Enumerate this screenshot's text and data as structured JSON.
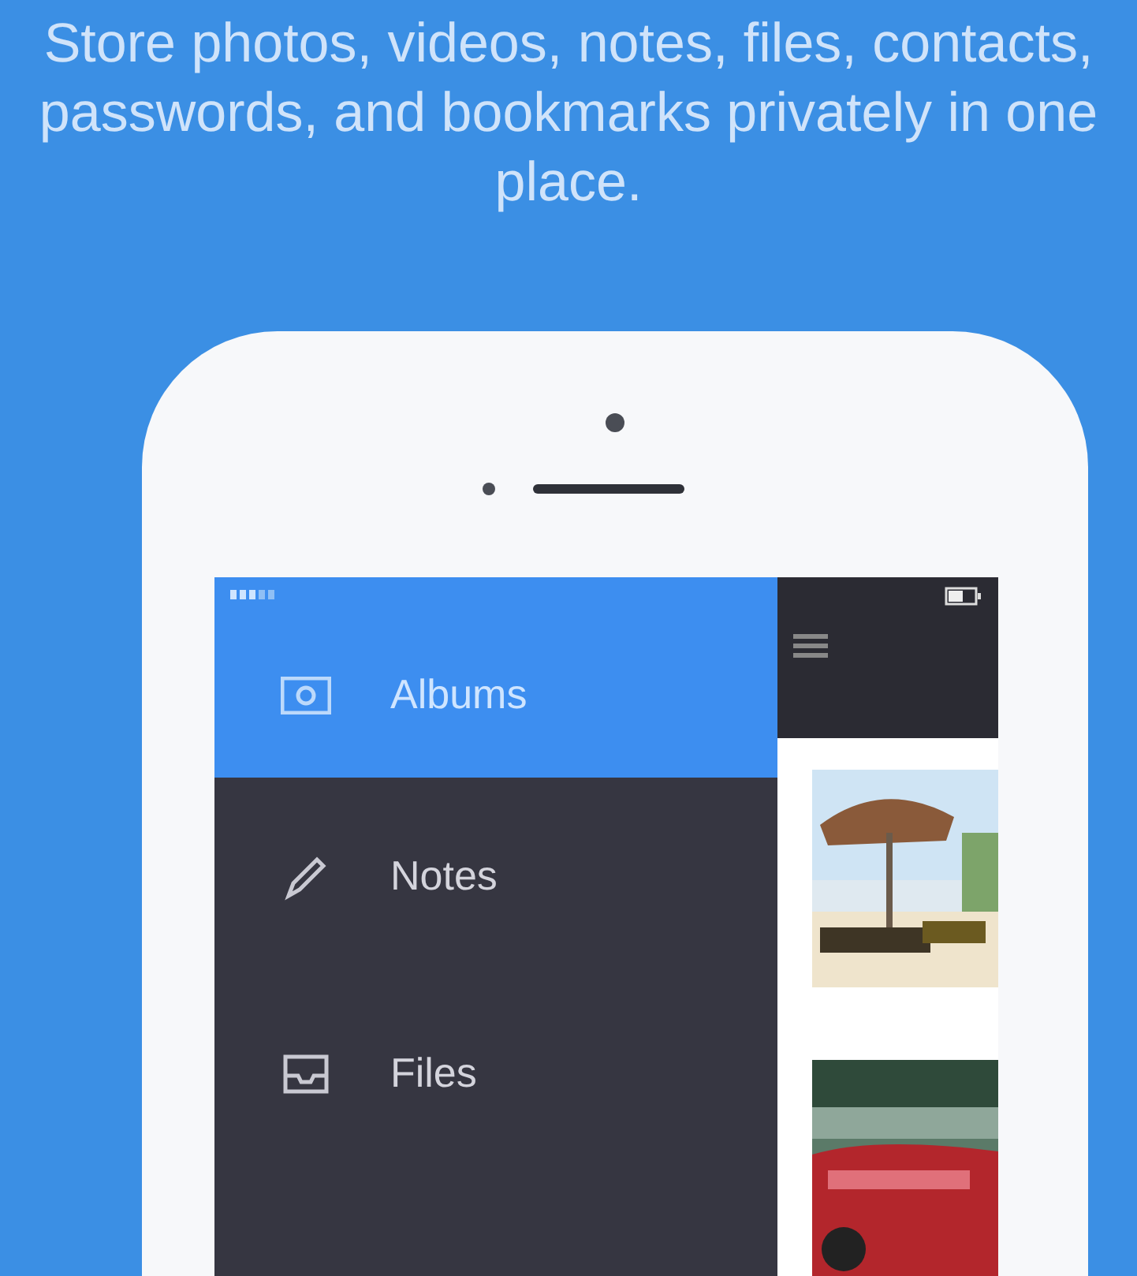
{
  "headline": "Store photos, videos, notes, files, contacts, passwords, and bookmarks privately in one place.",
  "menu": [
    {
      "label": "Albums",
      "selected": true,
      "kind": "camera"
    },
    {
      "label": "Notes",
      "selected": false,
      "kind": "pencil"
    },
    {
      "label": "Files",
      "selected": false,
      "kind": "tray"
    }
  ]
}
